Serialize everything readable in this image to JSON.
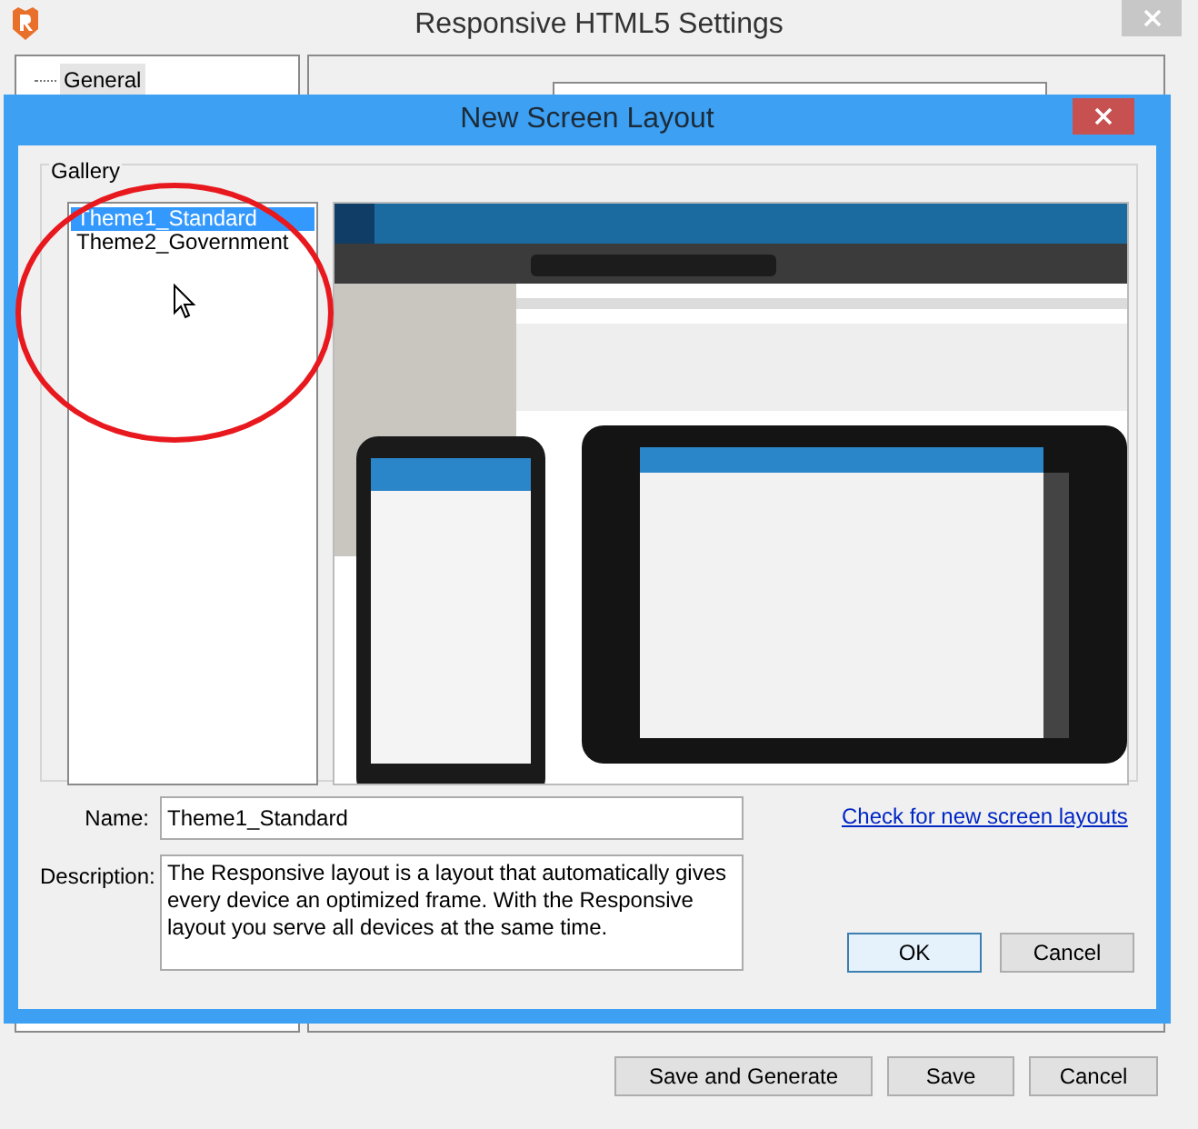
{
  "window": {
    "title": "Responsive HTML5 Settings"
  },
  "settings_tree": {
    "items": [
      {
        "label": "General",
        "selected": true
      }
    ]
  },
  "footer_buttons": [
    "Save and Generate",
    "Save",
    "Cancel"
  ],
  "dialog": {
    "title": "New Screen Layout",
    "gallery": {
      "label": "Gallery",
      "items": [
        {
          "label": "Theme1_Standard",
          "selected": true
        },
        {
          "label": "Theme2_Government",
          "selected": false
        }
      ]
    },
    "name": {
      "label": "Name:",
      "value": "Theme1_Standard"
    },
    "description": {
      "label": "Description:",
      "value": "The Responsive layout is a layout that automatically gives every device an optimized frame. With the Responsive layout you serve all devices at the same time."
    },
    "link": "Check for new screen layouts",
    "buttons": [
      {
        "label": "OK",
        "default": true
      },
      {
        "label": "Cancel",
        "default": false
      }
    ]
  }
}
